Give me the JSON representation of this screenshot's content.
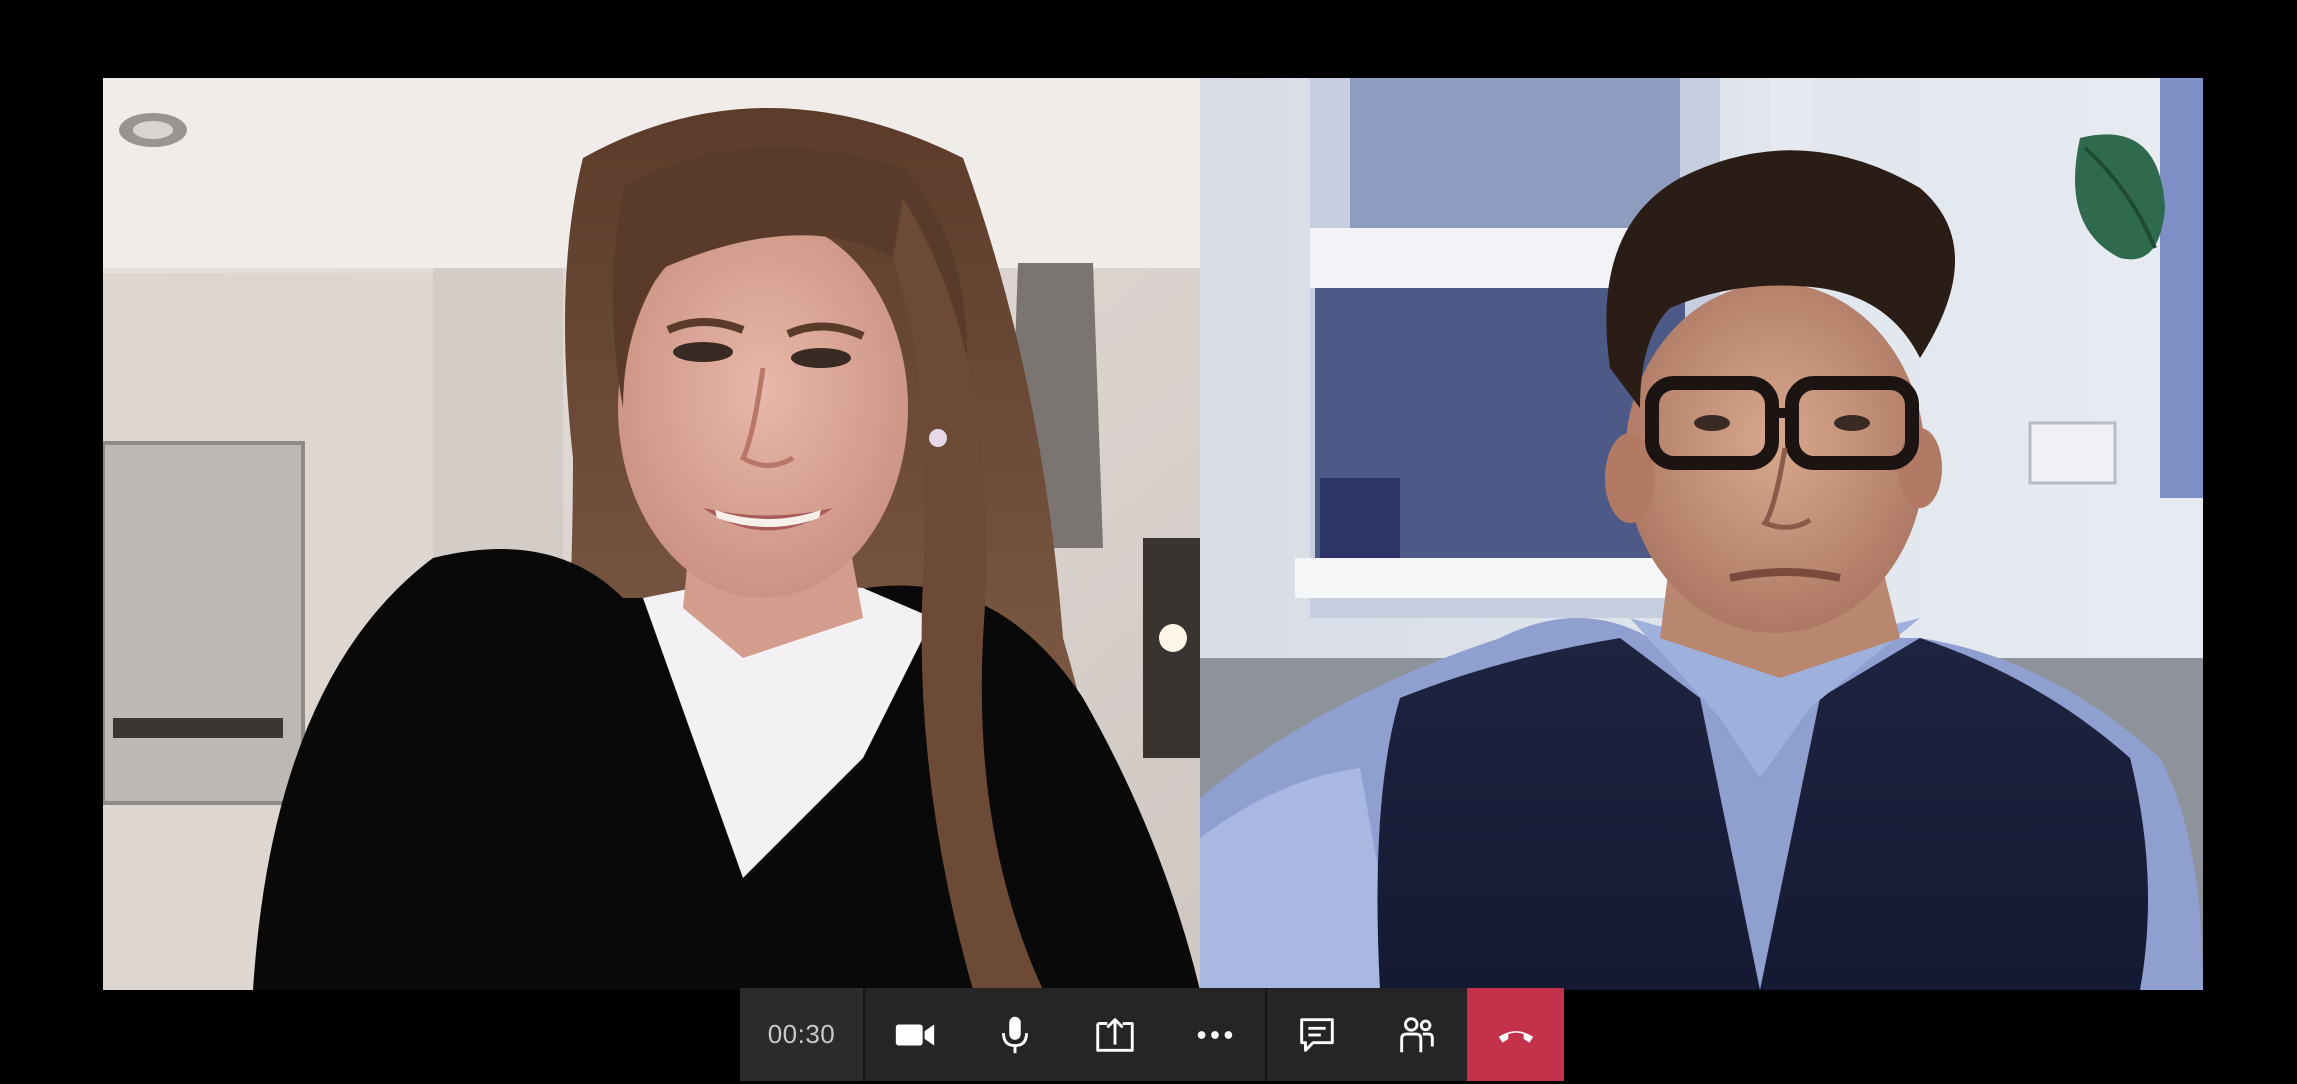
{
  "call": {
    "duration": "00:30"
  },
  "participants": [
    {
      "role": "participant-left"
    },
    {
      "role": "participant-right"
    }
  ],
  "controls": {
    "camera_icon": "video-camera-icon",
    "mic_icon": "microphone-icon",
    "share_icon": "share-screen-icon",
    "more_icon": "more-options-icon",
    "chat_icon": "chat-icon",
    "people_icon": "participants-icon",
    "hangup_icon": "hang-up-icon"
  },
  "colors": {
    "background": "#000000",
    "toolbar": "#252525",
    "timer_bg": "#2b2b2b",
    "hangup": "#c4314b",
    "icon": "#ffffff"
  }
}
